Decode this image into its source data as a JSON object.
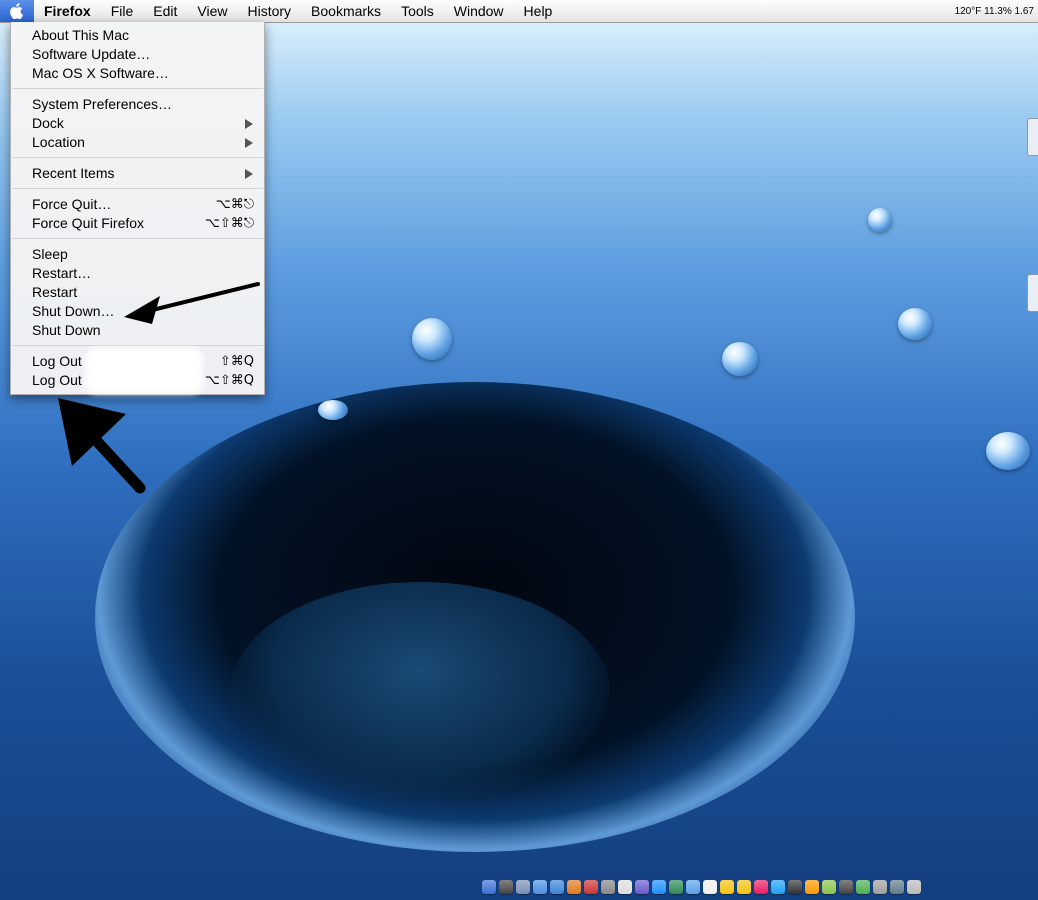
{
  "menubar": {
    "apple_icon": "apple-logo-icon",
    "app_name": "Firefox",
    "menus": [
      "File",
      "Edit",
      "View",
      "History",
      "Bookmarks",
      "Tools",
      "Window",
      "Help"
    ],
    "status_text": "120°F 11.3% 1.67"
  },
  "apple_menu": {
    "about": "About This Mac",
    "software_update": "Software Update…",
    "macosx_software": "Mac OS X Software…",
    "system_preferences": "System Preferences…",
    "dock": "Dock",
    "location": "Location",
    "recent_items": "Recent Items",
    "force_quit": "Force Quit…",
    "force_quit_shortcut": "⌥⌘⎋",
    "force_quit_app": "Force Quit Firefox",
    "force_quit_app_shortcut": "⌥⇧⌘⎋",
    "sleep": "Sleep",
    "restart_dots": "Restart…",
    "restart": "Restart",
    "shut_down_dots": "Shut Down…",
    "shut_down": "Shut Down",
    "log_out_1": "Log Out",
    "log_out_1_shortcut": "⇧⌘Q",
    "log_out_2": "Log Out",
    "log_out_2_shortcut": "⌥⇧⌘Q"
  },
  "dock": {
    "icon_colors": [
      "#3b6fd6",
      "#444",
      "#7a8fb5",
      "#4a90e2",
      "#3a85d8",
      "#e07a1f",
      "#c33",
      "#888",
      "#ddd",
      "#6a5acd",
      "#1e90ff",
      "#2e8b57",
      "#5aa0e8",
      "#eee",
      "#f4c20d",
      "#f4c20d",
      "#e91e63",
      "#1da1f2",
      "#333",
      "#ff9800",
      "#8bc34a",
      "#444",
      "#4caf50",
      "#9e9e9e",
      "#607d8b",
      "#bbb"
    ]
  }
}
